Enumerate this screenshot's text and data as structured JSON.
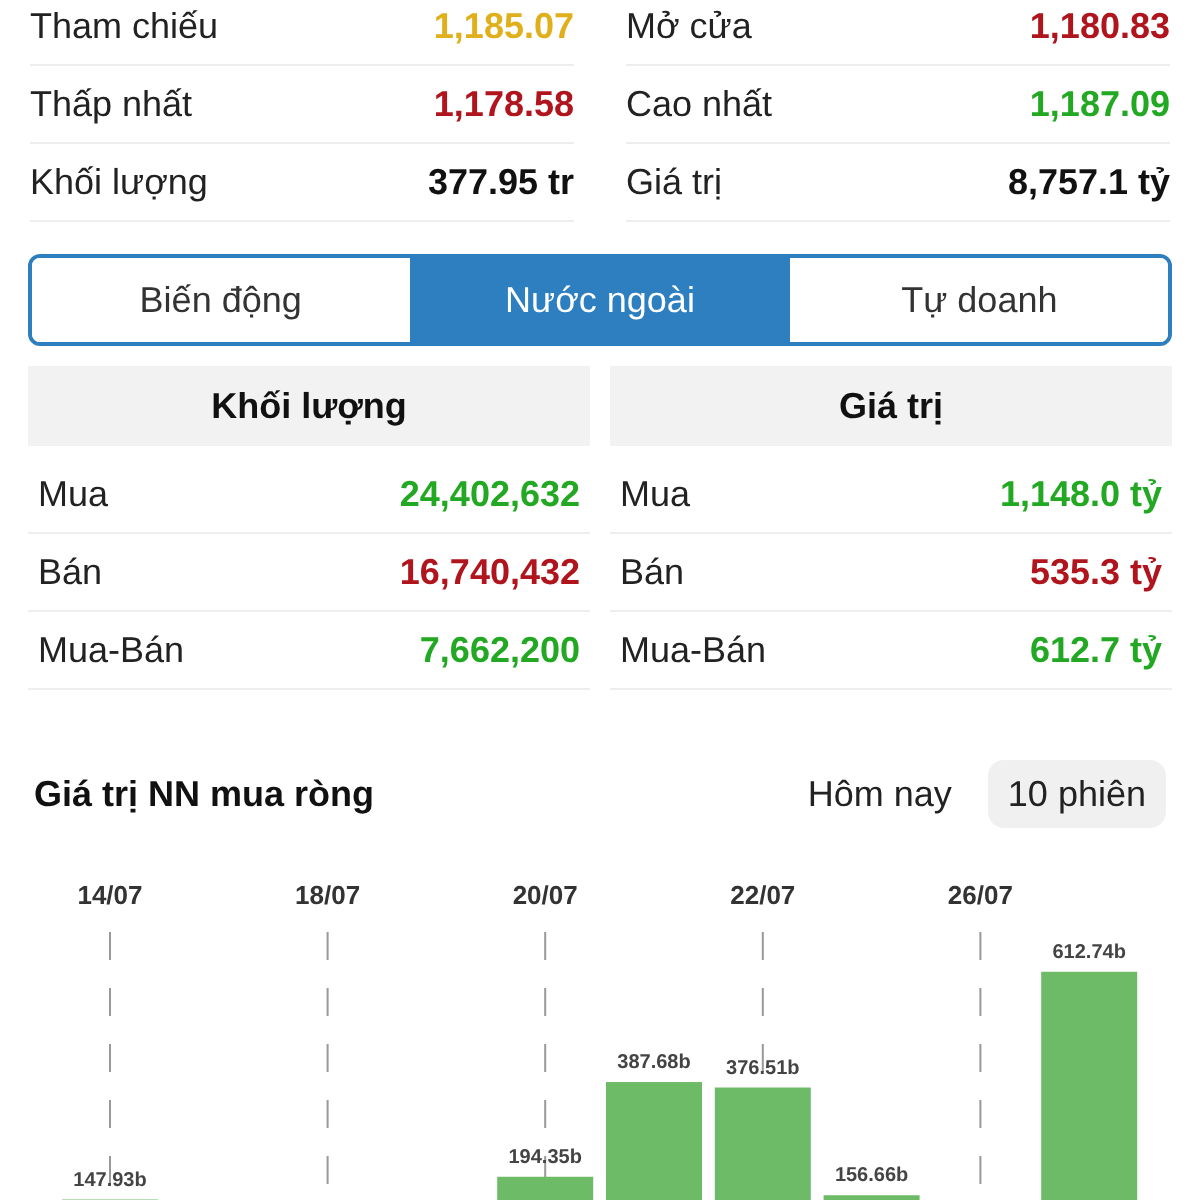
{
  "stats": [
    {
      "label": "Tham chiếu",
      "value": "1,185.07",
      "color": "#e0b01c"
    },
    {
      "label": "Mở cửa",
      "value": "1,180.83",
      "color": "#b0141c"
    },
    {
      "label": "Thấp nhất",
      "value": "1,178.58",
      "color": "#b0141c"
    },
    {
      "label": "Cao nhất",
      "value": "1,187.09",
      "color": "#23a823"
    },
    {
      "label": "Khối lượng",
      "value": "377.95 tr",
      "color": "#111111"
    },
    {
      "label": "Giá trị",
      "value": "8,757.1 tỷ",
      "color": "#111111"
    }
  ],
  "tabs": [
    {
      "label": "Biến động",
      "selected": false
    },
    {
      "label": "Nước ngoài",
      "selected": true
    },
    {
      "label": "Tự doanh",
      "selected": false
    }
  ],
  "tables": [
    {
      "heading": "Khối lượng",
      "rows": [
        {
          "label": "Mua",
          "value": "24,402,632",
          "color": "#23a823"
        },
        {
          "label": "Bán",
          "value": "16,740,432",
          "color": "#b0141c"
        },
        {
          "label": "Mua-Bán",
          "value": "7,662,200",
          "color": "#23a823"
        }
      ]
    },
    {
      "heading": "Giá trị",
      "rows": [
        {
          "label": "Mua",
          "value": "1,148.0 tỷ",
          "color": "#23a823"
        },
        {
          "label": "Bán",
          "value": "535.3 tỷ",
          "color": "#b0141c"
        },
        {
          "label": "Mua-Bán",
          "value": "612.7 tỷ",
          "color": "#23a823"
        }
      ]
    }
  ],
  "chart_section": {
    "title": "Giá trị NN mua ròng",
    "periods": [
      {
        "label": "Hôm nay",
        "selected": false
      },
      {
        "label": "10 phiên",
        "selected": true
      }
    ],
    "chart_data": {
      "type": "bar",
      "grid": true,
      "categories": [
        "14/07",
        null,
        "18/07",
        null,
        "20/07",
        null,
        "22/07",
        null,
        "26/07",
        null
      ],
      "values": [
        147.93,
        null,
        null,
        null,
        194.35,
        387.68,
        376.51,
        156.66,
        null,
        612.74
      ],
      "value_labels": [
        "147.93b",
        null,
        null,
        null,
        "194.35b",
        "387.68b",
        "376.51b",
        "156.66b",
        null,
        "612.74b"
      ]
    }
  }
}
